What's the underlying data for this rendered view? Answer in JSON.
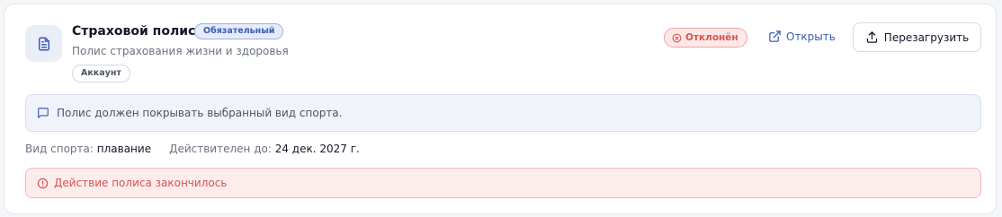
{
  "document": {
    "title": "Страховой полис",
    "requirement_badge": "Обязательный",
    "subtitle": "Полис страхования жизни и здоровья",
    "scope_tag": "Аккаунт"
  },
  "status": {
    "label": "Отклонён",
    "color": "#d9534f"
  },
  "actions": {
    "open_label": "Открыть",
    "reupload_label": "Перезагрузить"
  },
  "info": {
    "message": "Полис должен покрывать выбранный вид спорта."
  },
  "details": {
    "sport_label": "Вид спорта:",
    "sport_value": "плавание",
    "valid_until_label": "Действителен до:",
    "valid_until_value": "24 дек. 2027 г."
  },
  "error": {
    "message": "Действие полиса закончилось"
  },
  "colors": {
    "accent": "#3b5bb8",
    "danger": "#d9534f"
  },
  "icons": {
    "document": "document-icon",
    "status": "x-circle-icon",
    "open": "external-link-icon",
    "reupload": "upload-icon",
    "info": "message-icon",
    "error": "alert-circle-icon"
  }
}
